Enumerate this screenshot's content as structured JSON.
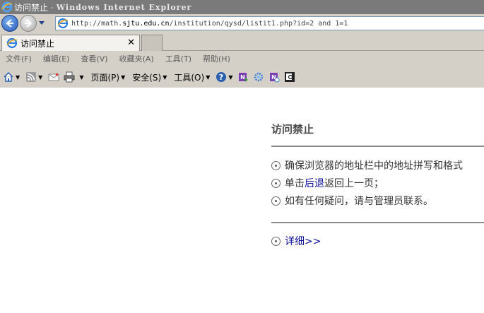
{
  "window": {
    "page_title": "访问禁止",
    "separator": "-",
    "app_title": "Windows Internet Explorer"
  },
  "address": {
    "url_prefix": "http://math.",
    "url_domain": "sjtu.edu.cn",
    "url_rest": "/institution/qysd/listit1.php?id=2 and 1=1"
  },
  "tabs": [
    {
      "label": "访问禁止",
      "close": "✕"
    }
  ],
  "menu": {
    "items": [
      "文件(F)",
      "编辑(E)",
      "查看(V)",
      "收藏夹(A)",
      "工具(T)",
      "帮助(H)"
    ]
  },
  "command_bar": {
    "page_label": "页面(P)",
    "safety_label": "安全(S)",
    "tools_label": "工具(O)"
  },
  "error_page": {
    "title": "访问禁止",
    "line1": "确保浏览器的地址栏中的地址拼写和格式",
    "line2_prefix": "单击",
    "line2_link": "后退",
    "line2_suffix": "返回上一页；",
    "line3": "如有任何疑问，请与管理员联系。",
    "details": "详细>>"
  },
  "colors": {
    "chrome": "#d4d0c8",
    "titlebar": "#7a7a7a",
    "link": "#0c0c99"
  }
}
